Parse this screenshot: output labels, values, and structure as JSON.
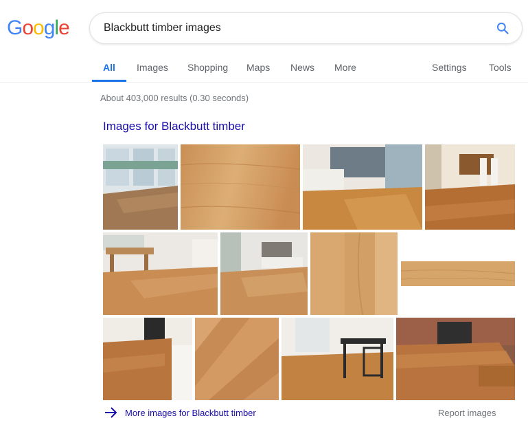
{
  "logo": {
    "letters": [
      "G",
      "o",
      "o",
      "g",
      "l",
      "e"
    ],
    "colors": [
      "#4285f4",
      "#ea4335",
      "#fbbc05",
      "#4285f4",
      "#34a853",
      "#ea4335"
    ]
  },
  "search": {
    "query": "Blackbutt timber images",
    "icon": "search-icon"
  },
  "tabs": [
    {
      "label": "All",
      "active": true
    },
    {
      "label": "Images",
      "active": false
    },
    {
      "label": "Shopping",
      "active": false
    },
    {
      "label": "Maps",
      "active": false
    },
    {
      "label": "News",
      "active": false
    },
    {
      "label": "More",
      "active": false
    },
    {
      "label": "Settings",
      "active": false
    },
    {
      "label": "Tools",
      "active": false
    }
  ],
  "result_stats": "About 403,000 results (0.30 seconds)",
  "image_pack": {
    "heading": "Images for Blackbutt timber",
    "more_label": "More images for Blackbutt timber",
    "report_label": "Report images",
    "images": [
      {
        "subject": "sunroom timber floor",
        "tone": "#a8825a"
      },
      {
        "subject": "blackbutt timber grain",
        "tone": "#d8a66c"
      },
      {
        "subject": "living room timber floor",
        "tone": "#c98a48"
      },
      {
        "subject": "dining room timber floor",
        "tone": "#b8743a"
      },
      {
        "subject": "dining bench timber floor",
        "tone": "#c98e55"
      },
      {
        "subject": "lounge room timber floor",
        "tone": "#c79058"
      },
      {
        "subject": "timber board close-up",
        "tone": "#dcae78"
      },
      {
        "subject": "timber board strip",
        "tone": "#d4a468"
      },
      {
        "subject": "hallway timber floor",
        "tone": "#b5733c"
      },
      {
        "subject": "timber floor close-up",
        "tone": "#cf9560"
      },
      {
        "subject": "dining table timber floor",
        "tone": "#c48443"
      },
      {
        "subject": "timber deck",
        "tone": "#b8733e"
      }
    ]
  },
  "colors": {
    "link": "#1a0dab",
    "accent": "#1a73e8",
    "muted": "#70757a"
  }
}
